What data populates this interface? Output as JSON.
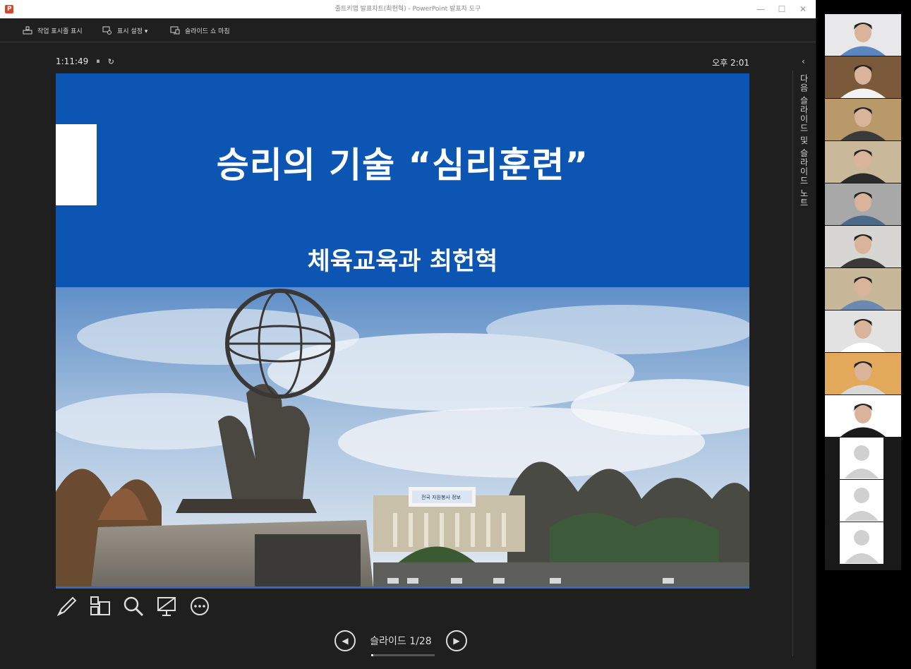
{
  "window": {
    "title": "줄트키맵 발표자트(최헌혁) - PowerPoint 발표자 도구",
    "controls": [
      "—",
      "☐",
      "✕"
    ]
  },
  "toolbar": {
    "taskbar_label": "작업 표시줄 표시",
    "display_settings_label": "표시 설정 ▾",
    "end_show_label": "슬라이드 쇼 마침"
  },
  "presenter": {
    "timer": "1:11:49",
    "pause_glyph": "⏸",
    "reset_glyph": "↻",
    "clock": "오후 2:01",
    "collapse_glyph": "‹",
    "notes_label": "다음 슬라이드 및 슬라이드 노트"
  },
  "slide": {
    "title": "승리의 기술 “심리훈련”",
    "subtitle": "체육교육과 최헌혁",
    "banner_text": "전국 자원봉사 정보",
    "colors": {
      "band": "#0c55b3",
      "text": "#ffffff"
    }
  },
  "navigation": {
    "counter": "슬라이드 1/28",
    "current": 1,
    "total": 28,
    "prev_glyph": "◀",
    "next_glyph": "▶"
  },
  "tools": [
    "pen-icon",
    "all-slides-icon",
    "zoom-icon",
    "black-screen-icon",
    "more-options-icon"
  ],
  "participants": [
    {
      "type": "video",
      "bg": "#e8e8ea",
      "shirt": "#5a86c2"
    },
    {
      "type": "video",
      "bg": "#7a5a3a",
      "shirt": "#f2f2f2"
    },
    {
      "type": "video",
      "bg": "#b89a6a",
      "shirt": "#3a3a3a"
    },
    {
      "type": "video",
      "bg": "#c9b89a",
      "shirt": "#2a2a2a"
    },
    {
      "type": "video",
      "bg": "#a8a8a8",
      "shirt": "#4a6a8a"
    },
    {
      "type": "video",
      "bg": "#d8d6d2",
      "shirt": "#3a3a3a"
    },
    {
      "type": "video",
      "bg": "#c8b89a",
      "shirt": "#6a8ab2"
    },
    {
      "type": "video",
      "bg": "#e2e2e2",
      "shirt": "#ffffff"
    },
    {
      "type": "video",
      "bg": "#e3a95a",
      "shirt": "#d8d8d8"
    },
    {
      "type": "video",
      "bg": "#ffffff",
      "shirt": "#1a1a1a"
    },
    {
      "type": "placeholder"
    },
    {
      "type": "placeholder"
    },
    {
      "type": "placeholder"
    }
  ]
}
